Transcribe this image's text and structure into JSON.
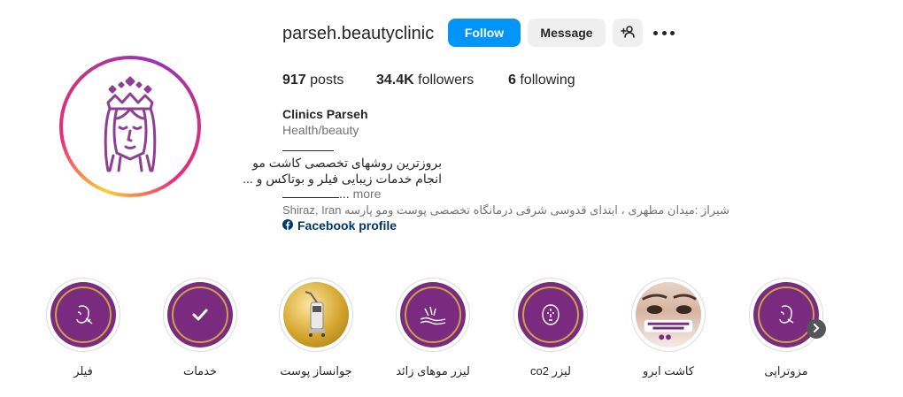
{
  "profile": {
    "username": "parseh.beautyclinic",
    "follow_label": "Follow",
    "message_label": "Message",
    "posts_count": "917",
    "posts_label": "posts",
    "followers_count": "34.4K",
    "followers_label": "followers",
    "following_count": "6",
    "following_label": "following",
    "display_name": "Clinics Parseh",
    "category": "Health/beauty",
    "bio_line1": "بروزترین روشهای تخصصی کاشت مو",
    "bio_line2": "انجام خدمات زیبایی فیلر و بوتاکس و ...",
    "bio_more_prefix": "...",
    "bio_more": "more",
    "address": "Shiraz, Iran شیراز :میدان مطهری ، ابتدای قدوسی شرقی درمانگاه تخصصی پوست ومو پارسه",
    "facebook_label": "Facebook profile"
  },
  "highlights": [
    {
      "label": "مزوتراپی",
      "icon": "face-icon"
    },
    {
      "label": "کاشت ابرو",
      "icon": "eyebrow-photo"
    },
    {
      "label": "لیزر co2",
      "icon": "face-icon"
    },
    {
      "label": "لیزر موهای زائد",
      "icon": "laser-icon"
    },
    {
      "label": "جوانساز پوست",
      "icon": "device-photo"
    },
    {
      "label": "خدمات",
      "icon": "check-icon"
    },
    {
      "label": "فیلر",
      "icon": "syringe-face-icon"
    }
  ],
  "colors": {
    "follow_button": "#0095f6",
    "highlight_purple": "#7b2b7f",
    "highlight_gold_ring": "#c9a04c",
    "logo_purple": "#8e3f93"
  }
}
